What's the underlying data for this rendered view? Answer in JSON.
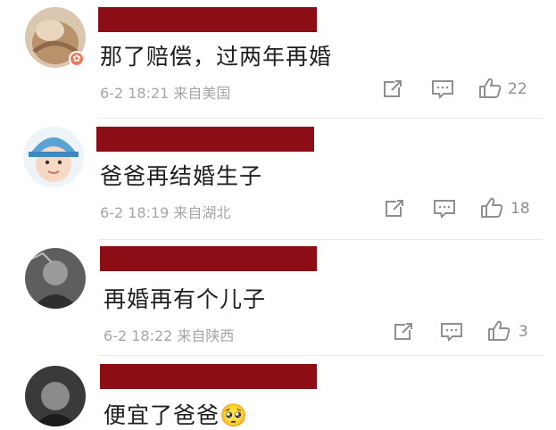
{
  "comments": [
    {
      "text": "那了赔偿，过两年再婚",
      "time": "6-2 18:21",
      "location": "来自美国",
      "likes": "22"
    },
    {
      "text": "爸爸再结婚生子",
      "time": "6-2 18:19",
      "location": "来自湖北",
      "likes": "18"
    },
    {
      "text": "再婚再有个儿子",
      "time": "6-2 18:22",
      "location": "来自陕西",
      "likes": "3"
    },
    {
      "text": "便宜了爸爸",
      "emoji": "🥺"
    }
  ],
  "colors": {
    "redaction": "#8c0d16",
    "meta_text": "#a6a6a6",
    "body_text": "#1e1e1e"
  },
  "icons": [
    "share-icon",
    "comment-icon",
    "like-icon"
  ]
}
